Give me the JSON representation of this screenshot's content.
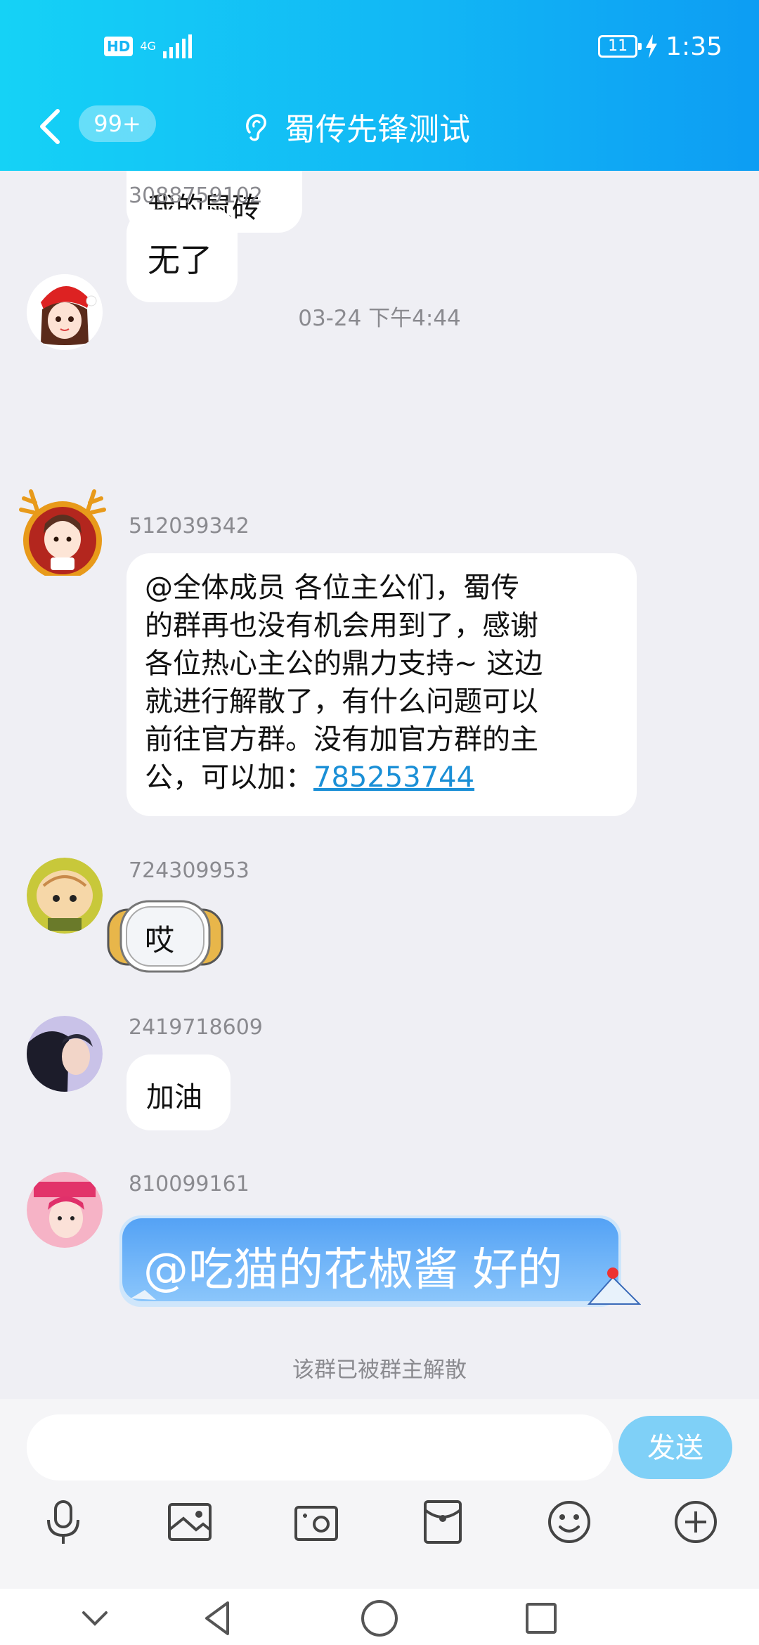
{
  "status_bar": {
    "left_badge": "HD",
    "network": "4G",
    "battery": "11",
    "time": "1:35"
  },
  "header": {
    "unread_badge": "99+",
    "title": "蜀传先锋测试"
  },
  "messages": [
    {
      "sender": "",
      "content": "我的鼠砖",
      "type": "sticker-text"
    },
    {
      "sender": "3088759102",
      "content": "无了",
      "type": "sticker-text"
    },
    {
      "timestamp": "03-24 下午4:44"
    },
    {
      "sender": "512039342",
      "type": "text",
      "lines": [
        "@全体成员 各位主公们，蜀传",
        "的群再也没有机会用到了，感谢",
        "各位热心主公的鼎力支持~ 这边",
        "就进行解散了，有什么问题可以",
        "前往官方群。没有加官方群的主",
        "公，可以加："
      ],
      "link": "785253744"
    },
    {
      "sender": "724309953",
      "content": "哎",
      "type": "themed-bubble"
    },
    {
      "sender": "2419718609",
      "content": "加油",
      "type": "sticker-text"
    },
    {
      "sender": "810099161",
      "content": "@吃猫的花椒酱 好的",
      "type": "themed-bubble-blue"
    }
  ],
  "notice": "该群已被群主解散",
  "input": {
    "placeholder": "",
    "send_label": "发送"
  },
  "toolbar_icons": [
    "microphone-icon",
    "image-icon",
    "camera-icon",
    "red-packet-icon",
    "emoji-icon",
    "plus-icon"
  ],
  "colors": {
    "header_start": "#15d2f6",
    "header_end": "#0d9df3",
    "send_button": "#7fd0f7",
    "link": "#1a8fd6"
  }
}
